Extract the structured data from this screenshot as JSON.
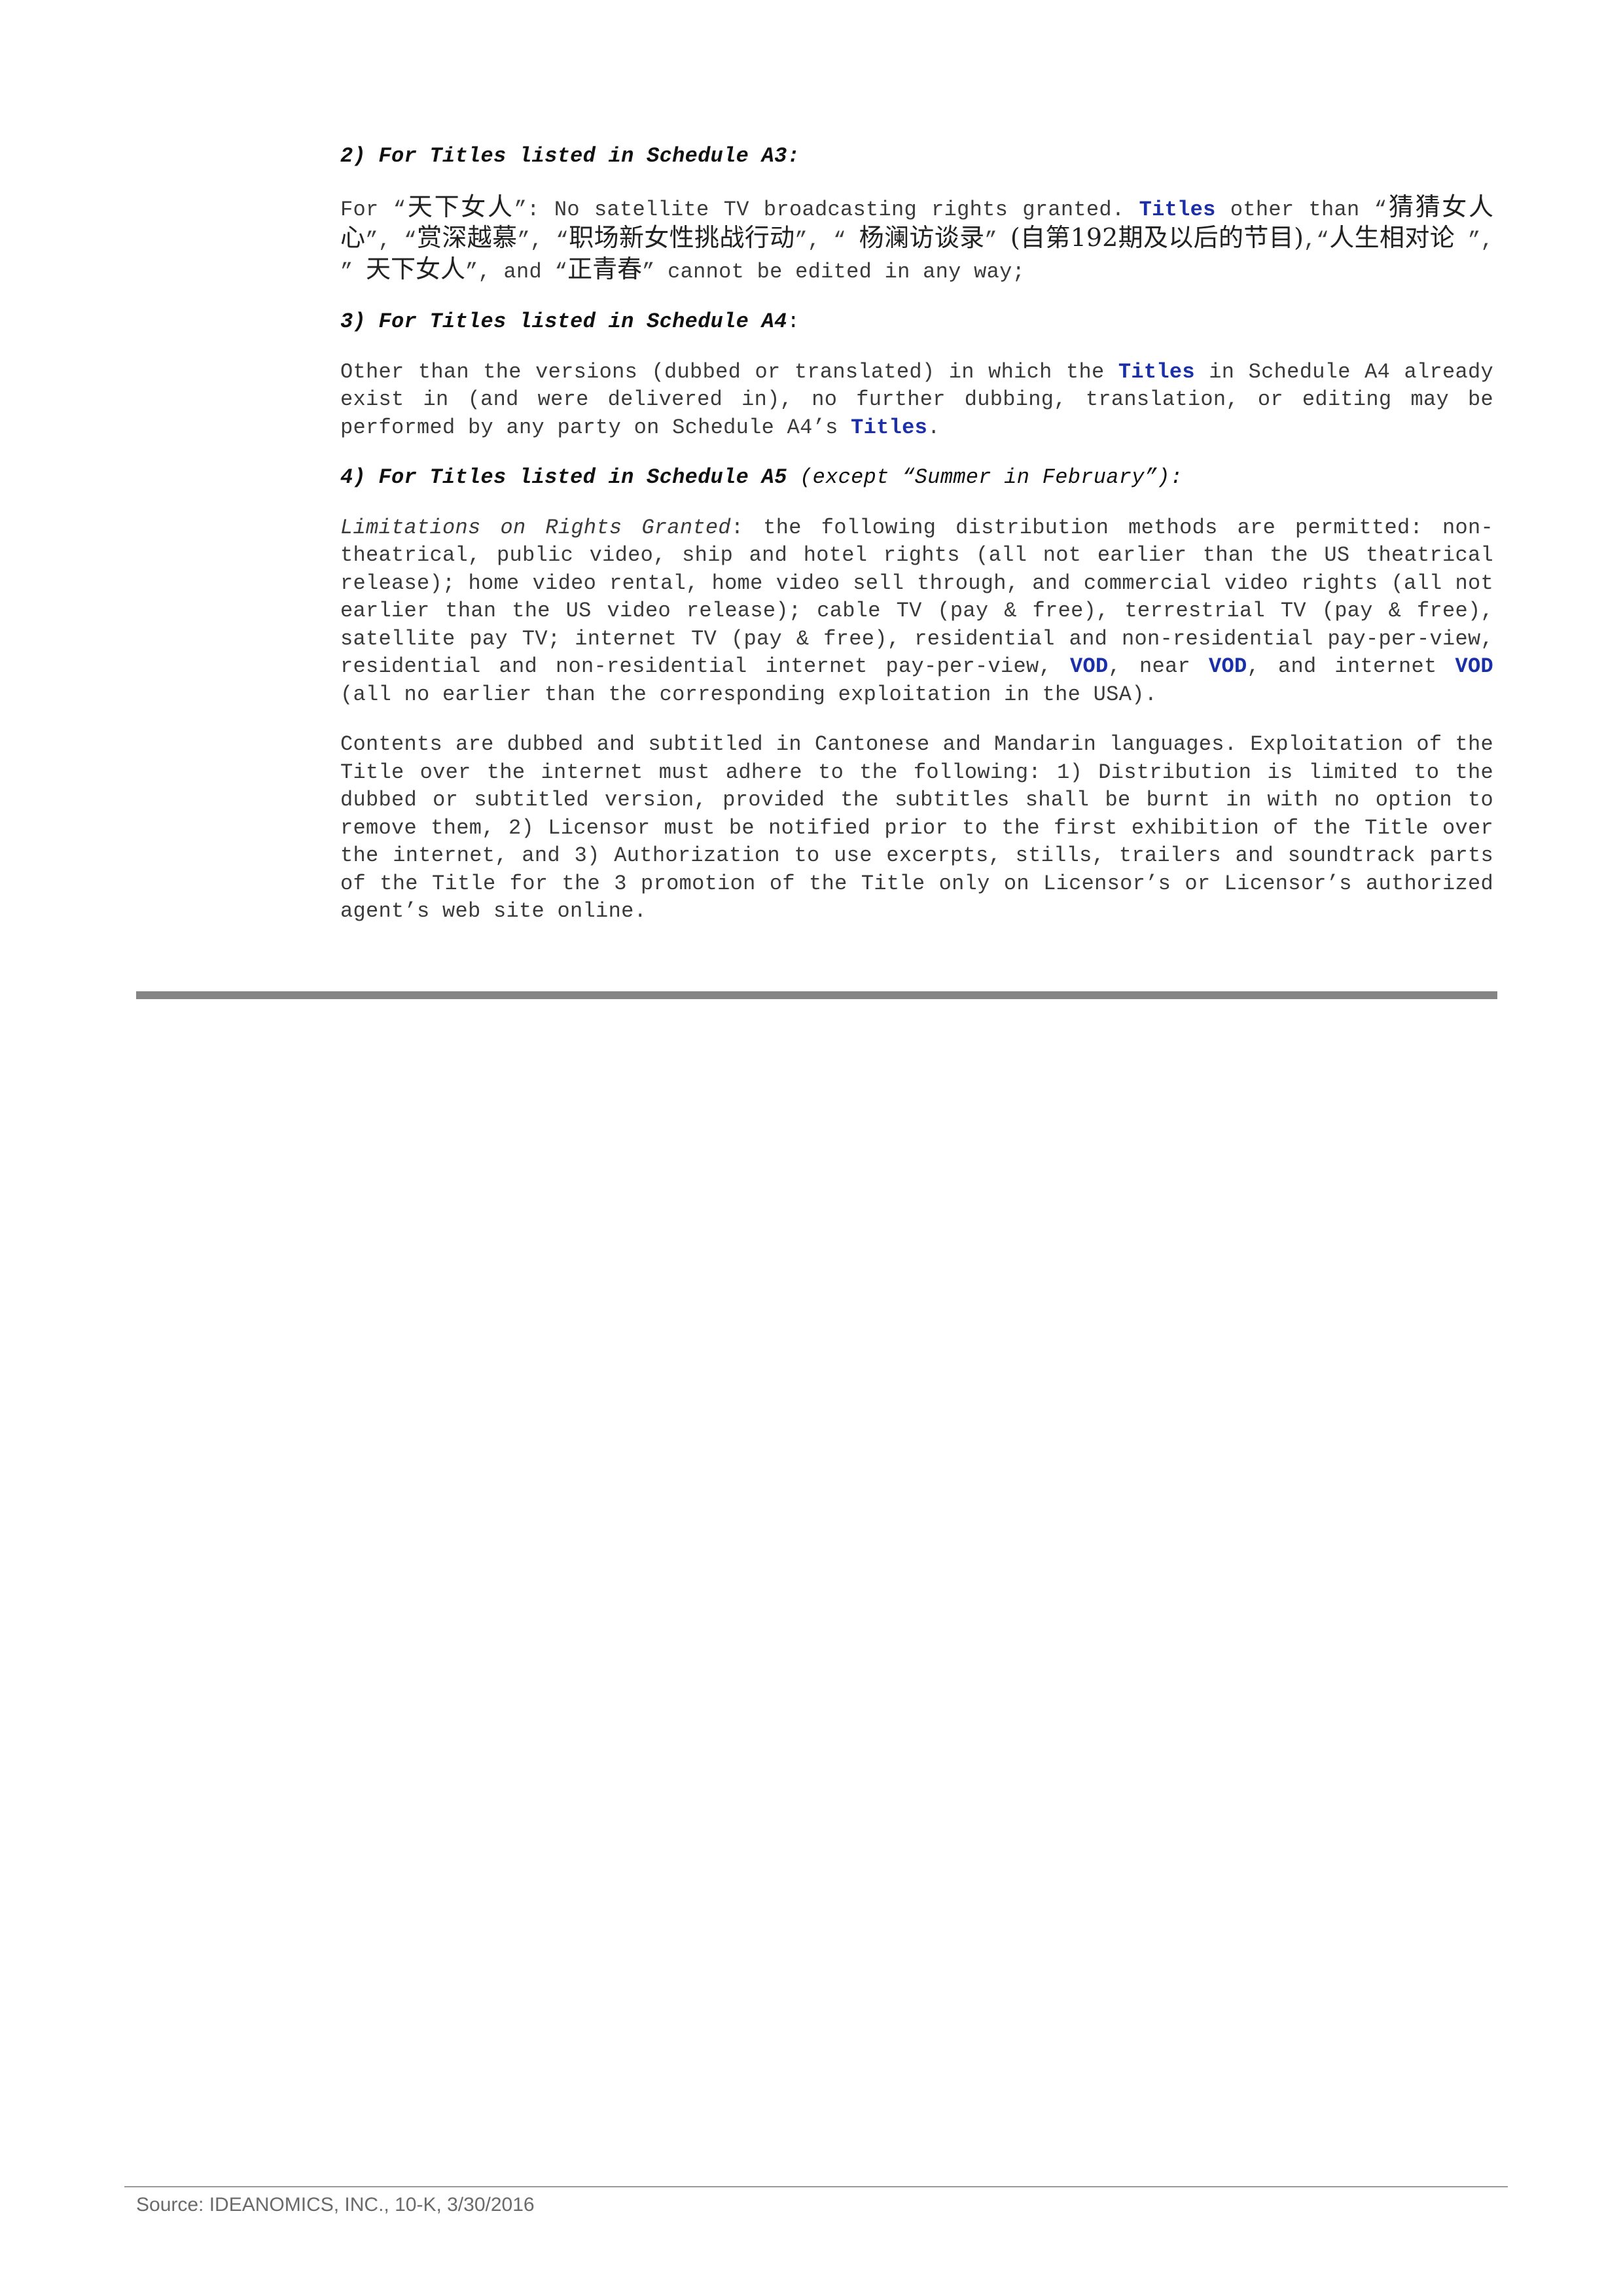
{
  "sections": {
    "a3": {
      "num": "2)",
      "title": "For Titles listed in Schedule A3:",
      "p1": "For “",
      "t1": "天下女人",
      "p2": "”: No satellite TV broadcasting rights granted.",
      "kw1": "Titles",
      "p3": "other than “",
      "t2": "猜猜女人心",
      "p4": "”, “",
      "t3": "赏深越慕",
      "p5": "”, “",
      "t4": "职场新女性挑战行动",
      "p6": "”, “",
      "t5": "杨澜访谈录",
      "p7": "”",
      "t6": "(自第192期及以后的节目)",
      "p8": ",“",
      "t7": "人生相对论",
      "p9": "”, ”",
      "t8": "天下女人",
      "p10": "”, and “",
      "t9": "正青春",
      "p11": "” cannot be edited in any way;"
    },
    "a4": {
      "num": "3)",
      "title": "For Titles listed in Schedule A4",
      "colon": ":",
      "p1": "Other than the versions (dubbed or translated) in which the",
      "kw1": "Titles",
      "p2": "in Schedule A4 already exist in (and were delivered in), no further dubbing, translation, or editing may be performed by any party on Schedule A4’s",
      "kw2": "Titles",
      "p3": "."
    },
    "a5": {
      "num": "4)",
      "title": "For Titles listed in Schedule A5",
      "note": "(except “Summer in February”):",
      "lead": "Limitations on Rights Granted",
      "p1": ": the following distribution methods are permitted: non-theatrical, public video, ship and hotel rights (all not earlier than the US theatrical release); home video rental, home video sell through, and commercial video rights (all not earlier than the US video release); cable TV (pay & free), terrestrial TV (pay & free), satellite pay TV; internet TV (pay & free), residential and non-residential pay-per-view, residential and non-residential internet pay-per-view,",
      "kw1": "VOD",
      "p2": ", near",
      "kw2": "VOD",
      "p3": ", and internet",
      "kw3": "VOD",
      "p4": "(all no earlier than the corresponding exploitation in the USA).",
      "para2": "Contents are dubbed and subtitled in Cantonese and Mandarin languages. Exploitation of the Title over the internet must adhere to the following: 1) Distribution is limited to the dubbed or subtitled version, provided the subtitles shall be burnt in with no option to remove them, 2) Licensor must be notified prior to the first exhibition of the Title over the internet, and 3) Authorization to use excerpts, stills, trailers and soundtrack parts of the Title for the 3 promotion of the Title only on Licensor’s or Licensor’s authorized agent’s web site online."
    }
  },
  "footer": {
    "source": "Source: IDEANOMICS, INC., 10-K, 3/30/2016"
  },
  "colors": {
    "keyword": "#1a2fa8",
    "rule": "#858585"
  }
}
